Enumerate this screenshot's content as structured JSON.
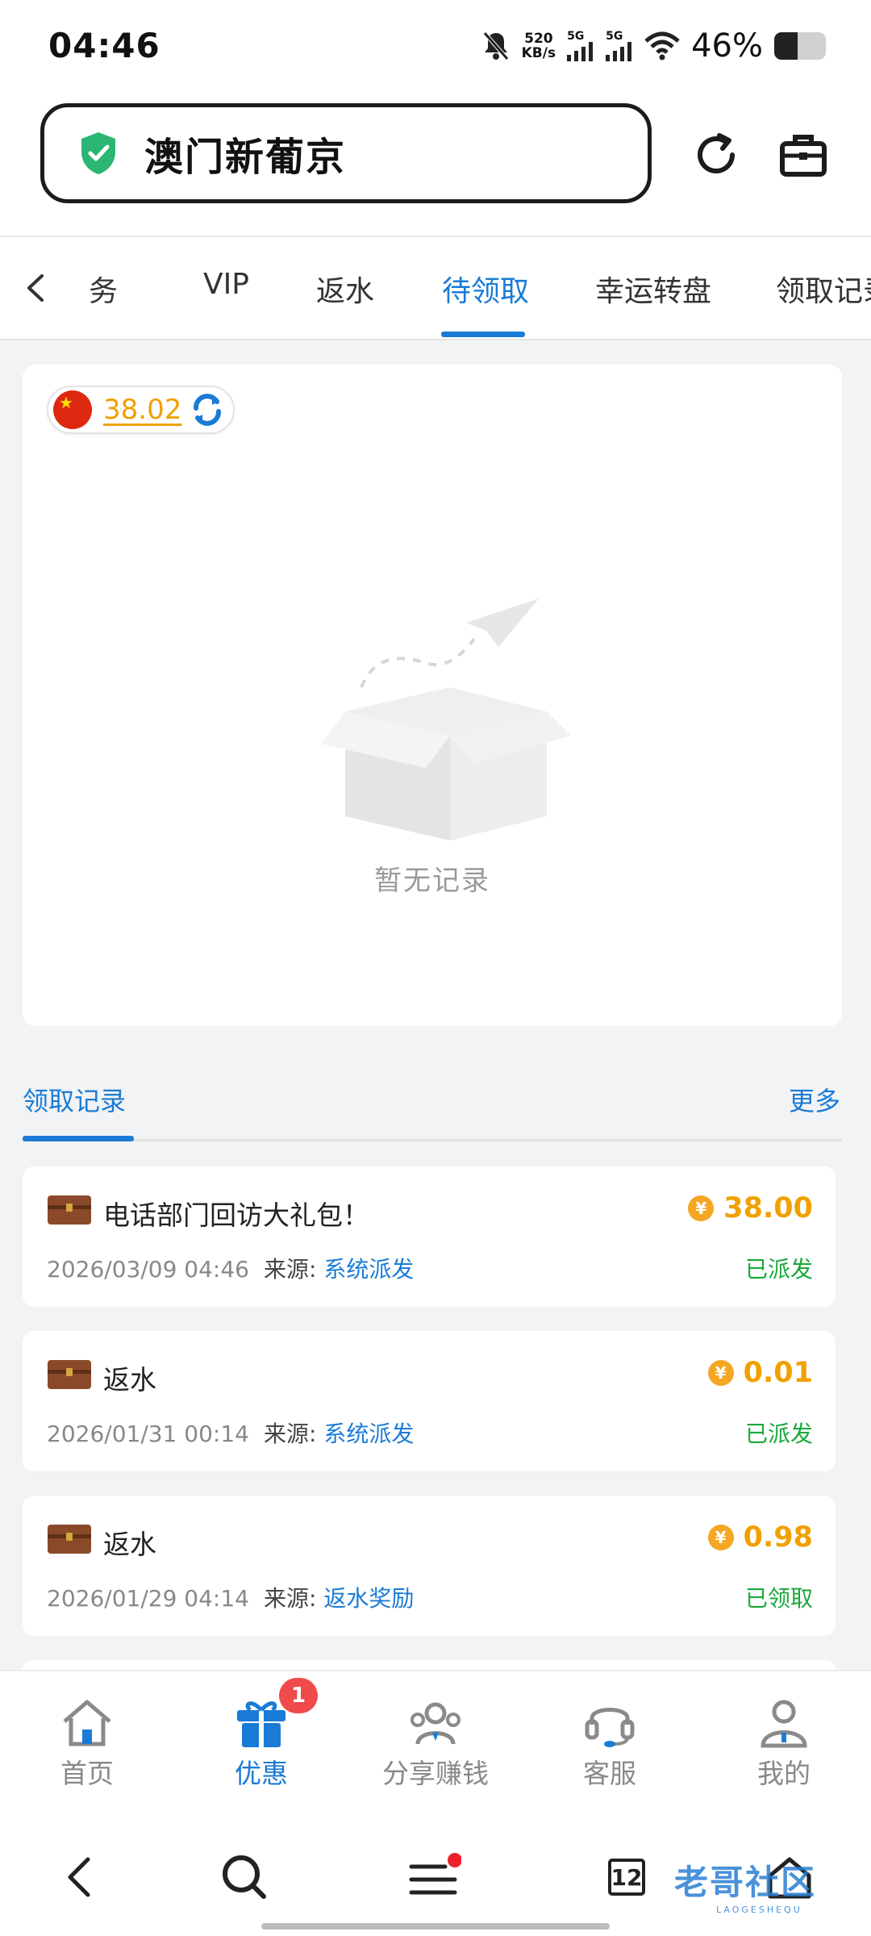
{
  "status_bar": {
    "time": "04:46",
    "net_speed_value": "520",
    "net_speed_unit": "KB/s",
    "sim1": "5G",
    "sim2": "5G",
    "battery": "46%",
    "battery_level": 0.46
  },
  "url_bar": {
    "site_title": "澳门新葡京"
  },
  "tabs": {
    "items": [
      "任务",
      "VIP",
      "返水",
      "待领取",
      "幸运转盘",
      "领取记录"
    ],
    "partial_left": "务",
    "active": "待领取"
  },
  "pending_card": {
    "balance": "38.02",
    "empty_text": "暂无记录"
  },
  "records_section": {
    "title": "领取记录",
    "more": "更多",
    "source_label": "来源:",
    "items": [
      {
        "name": "电话部门回访大礼包！",
        "amount": "38.00",
        "time": "2026/03/09 04:46",
        "source": "系统派发",
        "status": "已派发"
      },
      {
        "name": "返水",
        "amount": "0.01",
        "time": "2026/01/31 00:14",
        "source": "系统派发",
        "status": "已派发"
      },
      {
        "name": "返水",
        "amount": "0.98",
        "time": "2026/01/29 04:14",
        "source": "返水奖励",
        "status": "已领取"
      }
    ]
  },
  "bottom_nav": {
    "items": [
      {
        "label": "首页",
        "icon": "home-icon"
      },
      {
        "label": "优惠",
        "icon": "gift-icon"
      },
      {
        "label": "分享赚钱",
        "icon": "share-users-icon"
      },
      {
        "label": "客服",
        "icon": "headset-icon"
      },
      {
        "label": "我的",
        "icon": "user-icon"
      }
    ],
    "badge": "1"
  },
  "system_nav": {
    "tab_count": "12"
  },
  "watermark": {
    "text": "老哥社区",
    "sub": "LAOGESHEQU"
  },
  "colors": {
    "accent": "#1a7bd6",
    "gold": "#f0a000",
    "success": "#19a83a",
    "badge": "#f04a4a"
  }
}
